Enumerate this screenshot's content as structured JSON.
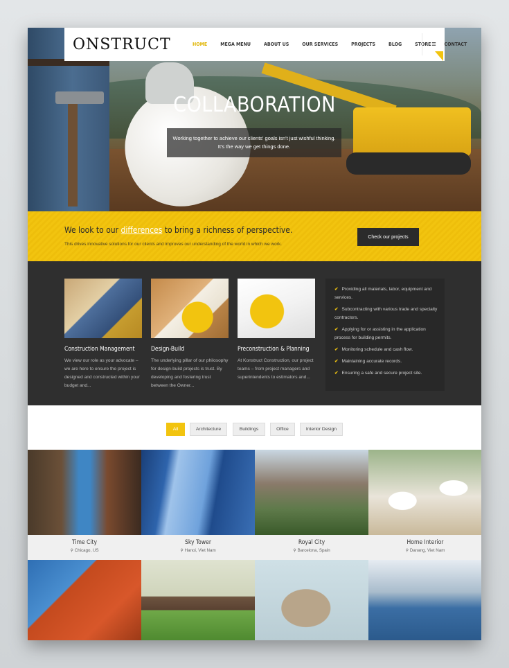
{
  "header": {
    "logo": "ONSTRUCT",
    "nav": [
      "HOME",
      "MEGA MENU",
      "ABOUT US",
      "OUR SERVICES",
      "PROJECTS",
      "BLOG",
      "STORE",
      "CONTACT"
    ],
    "menu_icon": "hamburger-icon",
    "accent": "#f2c40f"
  },
  "hero": {
    "title": "COLLABORATION",
    "line1": "Working together to achieve our clients' goals isn't just wishful thinking.",
    "line2": "It's the way we get things done."
  },
  "band": {
    "heading_pre": "We look to our ",
    "heading_link": "differences",
    "heading_post": " to bring a richness of perspective.",
    "text": "This drives innovative solutions for our clients and improves our understanding of the world in which we work.",
    "button": "Check our projects"
  },
  "services": [
    {
      "title": "Construction Management",
      "text": "We view our role as your advocate – we are here to ensure the project is designed and constructed within your budget and..."
    },
    {
      "title": "Design-Build",
      "text": "The underlying pillar of our philosophy for design-build projects is trust. By developing and fostering trust between the Owner..."
    },
    {
      "title": "Preconstruction & Planning",
      "text": "At Konstruct Construction, our project teams – from project managers and superintendents to estimators and..."
    }
  ],
  "checklist": [
    "Providing all materials, labor, equipment and services.",
    "Subcontracting with various trade and specialty contractors.",
    "Applying for or assisting in the application process for building permits.",
    "Monitoring schedule and cash flow.",
    "Maintaining accurate records.",
    "Ensuring a safe and secure project site."
  ],
  "filters": [
    "All",
    "Architecture",
    "Buildings",
    "Office",
    "Interior Design"
  ],
  "projects": [
    {
      "name": "Time City",
      "location": "Chicago, US"
    },
    {
      "name": "Sky Tower",
      "location": "Hanoi, Viet Nam"
    },
    {
      "name": "Royal City",
      "location": "Barcelona, Spain"
    },
    {
      "name": "Home Interior",
      "location": "Danang, Viet Nam"
    }
  ]
}
